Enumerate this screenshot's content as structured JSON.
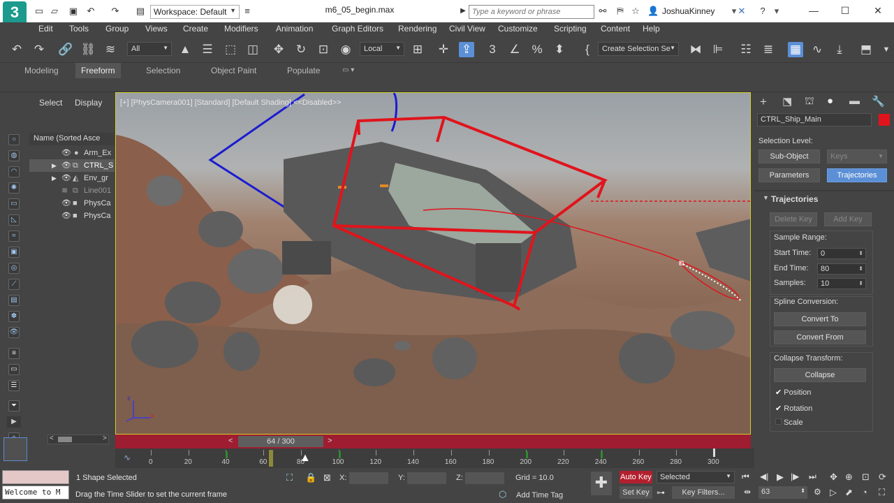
{
  "titlebar": {
    "logo": "3",
    "workspace": "Workspace: Default",
    "filename": "m6_05_begin.max",
    "search_placeholder": "Type a keyword or phrase",
    "username": "JoshuaKinney"
  },
  "menu": [
    "Edit",
    "Tools",
    "Group",
    "Views",
    "Create",
    "Modifiers",
    "Animation",
    "Graph Editors",
    "Rendering",
    "Civil View",
    "Customize",
    "Scripting",
    "Content",
    "Help"
  ],
  "toolbar": {
    "filter": "All",
    "coord_system": "Local",
    "selection_set": "Create Selection Se"
  },
  "ribbon": {
    "tabs": [
      "Modeling",
      "Freeform",
      "Selection",
      "Object Paint",
      "Populate"
    ],
    "active": "Freeform"
  },
  "scene_explorer": {
    "tabs": [
      "Select",
      "Display"
    ],
    "header": "Name (Sorted Asce",
    "items": [
      {
        "name": "Arm_Ex"
      },
      {
        "name": "CTRL_S"
      },
      {
        "name": "Env_gr"
      },
      {
        "name": "Line001"
      },
      {
        "name": "PhysCa"
      },
      {
        "name": "PhysCa"
      }
    ]
  },
  "viewport": {
    "label": "[+] [PhysCamera001] [Standard] [Default Shading]  <<Disabled>>"
  },
  "timeline": {
    "slider": "64 / 300",
    "ticks": [
      "0",
      "20",
      "40",
      "60",
      "80",
      "100",
      "120",
      "140",
      "160",
      "180",
      "200",
      "220",
      "240",
      "260",
      "280",
      "300"
    ]
  },
  "command_panel": {
    "object_name": "CTRL_Ship_Main",
    "object_color": "#e0141c",
    "selection_level_label": "Selection Level:",
    "sub_object": "Sub-Object",
    "keys": "Keys",
    "parameters": "Parameters",
    "trajectories_tab": "Trajectories",
    "rollout_title": "Trajectories",
    "delete_key": "Delete Key",
    "add_key": "Add Key",
    "sample_range": "Sample Range:",
    "start_time_label": "Start Time:",
    "start_time": "0",
    "end_time_label": "End Time:",
    "end_time": "80",
    "samples_label": "Samples:",
    "samples": "10",
    "spline_conversion": "Spline Conversion:",
    "convert_to": "Convert To",
    "convert_from": "Convert From",
    "collapse_transform": "Collapse Transform:",
    "collapse": "Collapse",
    "position": "Position",
    "rotation": "Rotation",
    "scale": "Scale"
  },
  "status": {
    "listener": "Welcome to M",
    "selection_info": "1 Shape Selected",
    "prompt": "Drag the Time Slider to set the current frame",
    "x_label": "X:",
    "y_label": "Y:",
    "z_label": "Z:",
    "grid": "Grid = 10.0",
    "add_time_tag": "Add Time Tag",
    "auto_key": "Auto Key",
    "selected": "Selected",
    "set_key": "Set Key",
    "key_filters": "Key Filters...",
    "frame": "63"
  }
}
